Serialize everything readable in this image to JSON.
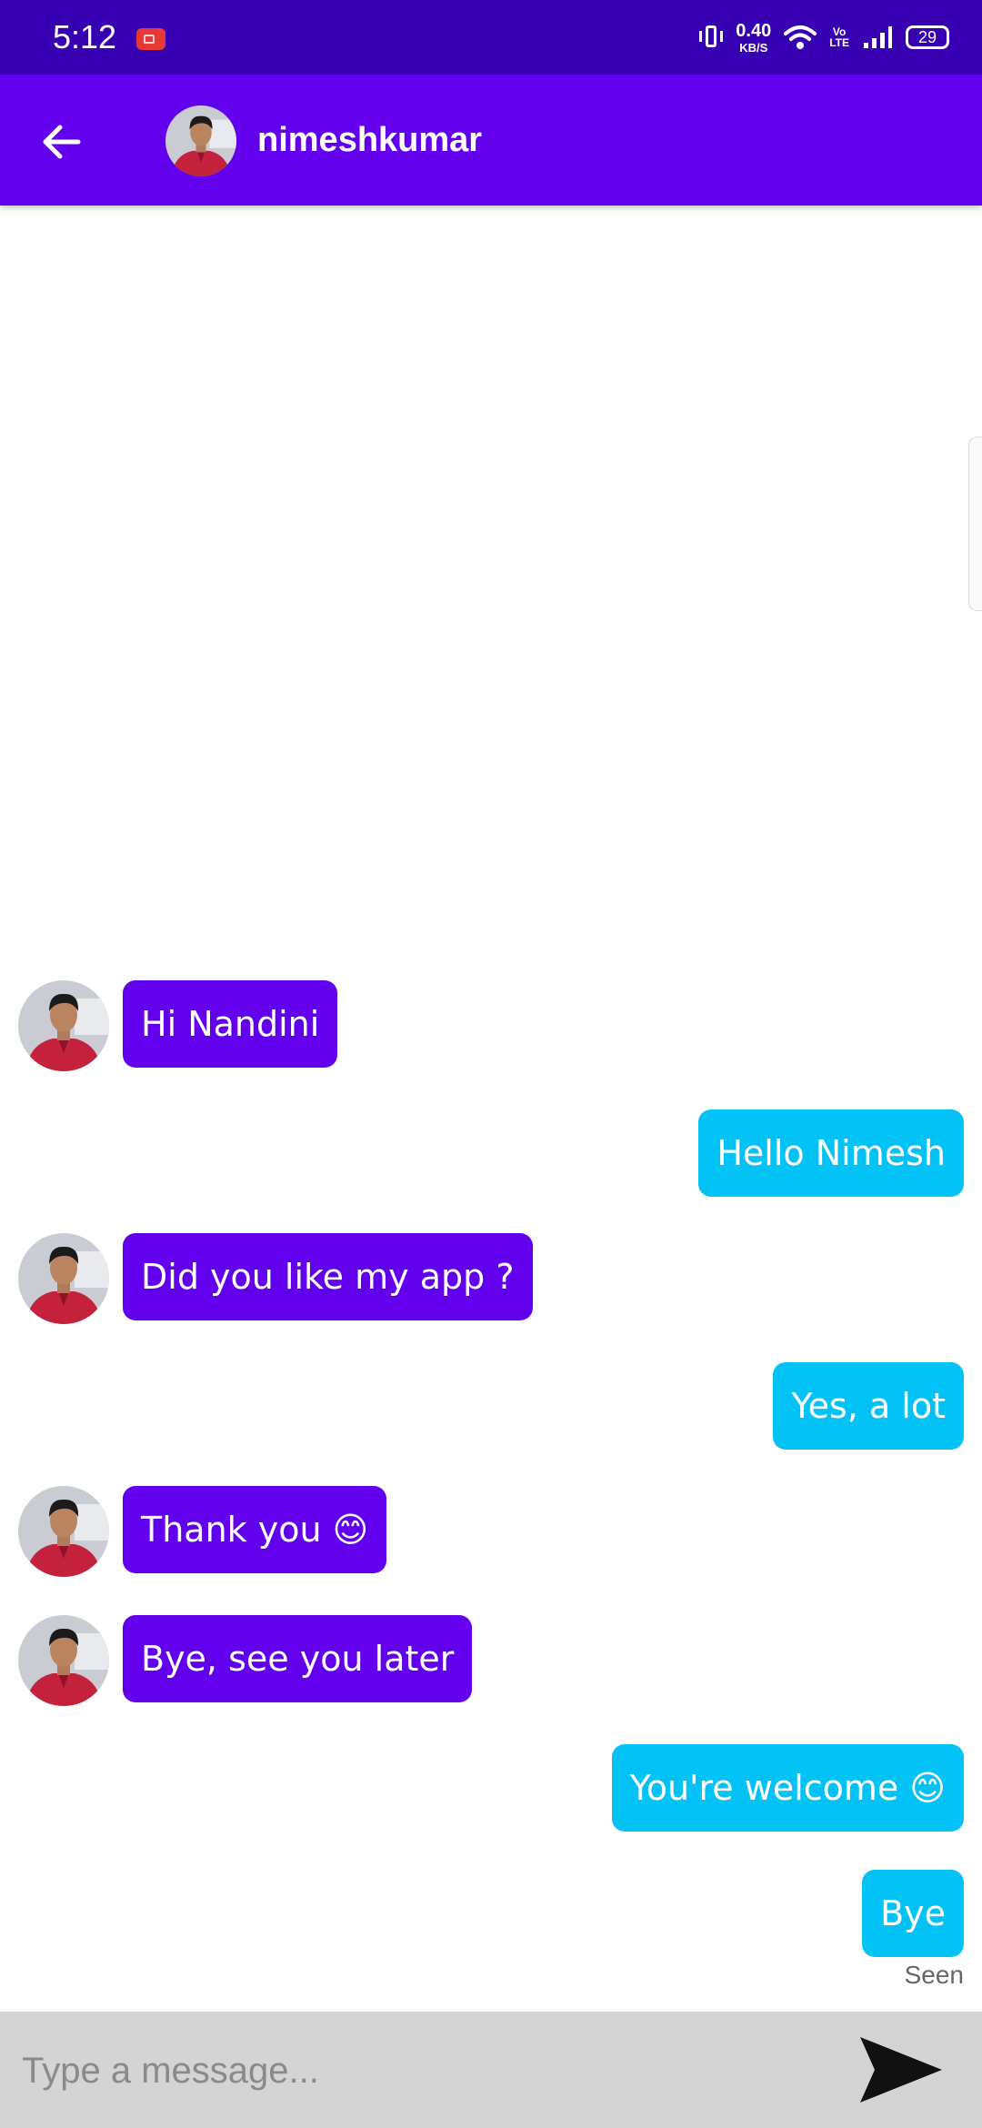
{
  "status_bar": {
    "time": "5:12",
    "net_speed_value": "0.40",
    "net_speed_unit": "KB/S",
    "volte_top": "Vo",
    "volte_bottom": "LTE",
    "battery": "29"
  },
  "header": {
    "contact_name": "nimeshkumar"
  },
  "messages": [
    {
      "direction": "incoming",
      "text": "Hi Nandini"
    },
    {
      "direction": "outgoing",
      "text": "Hello Nimesh"
    },
    {
      "direction": "incoming",
      "text": "Did you like my app ?"
    },
    {
      "direction": "outgoing",
      "text": "Yes, a lot"
    },
    {
      "direction": "incoming",
      "text": "Thank you 😊"
    },
    {
      "direction": "incoming",
      "text": "Bye, see you later"
    },
    {
      "direction": "outgoing",
      "text": "You're welcome 😊"
    },
    {
      "direction": "outgoing",
      "text": "Bye"
    }
  ],
  "seen_label": "Seen",
  "composer": {
    "placeholder": "Type a message...",
    "value": ""
  },
  "colors": {
    "status_bar": "#3700b3",
    "app_bar": "#6200ee",
    "incoming_bubble": "#6200ee",
    "outgoing_bubble": "#03c2f5",
    "composer_bg": "#d4d4d4"
  }
}
